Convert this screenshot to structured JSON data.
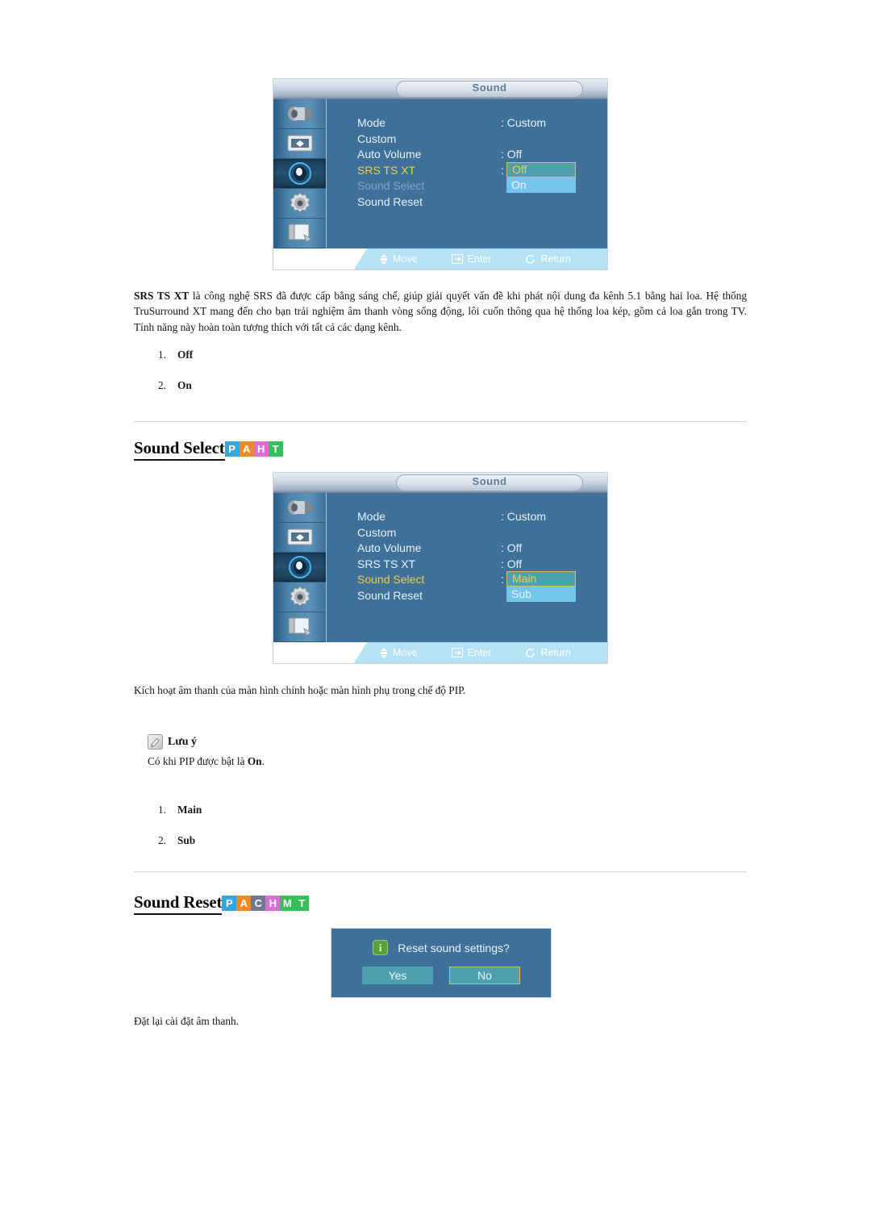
{
  "osd_menu_1": {
    "title": "Sound",
    "sidebar_icons": [
      "input-connector-icon",
      "picture-display-icon",
      "sound-speaker-icon",
      "setup-gear-icon",
      "multi-control-icon"
    ],
    "selected_sidebar_index": 2,
    "rows": [
      {
        "label": "Mode",
        "value": ": Custom",
        "state": "normal"
      },
      {
        "label": "Custom",
        "value": "",
        "state": "normal"
      },
      {
        "label": "Auto Volume",
        "value": ": Off",
        "state": "normal"
      },
      {
        "label": "SRS TS XT",
        "value": ":",
        "state": "active"
      },
      {
        "label": "Sound Select",
        "value": "",
        "state": "dim"
      },
      {
        "label": "Sound Reset",
        "value": "",
        "state": "normal"
      }
    ],
    "popup": {
      "selected": "Off",
      "other": "On"
    },
    "hints": [
      {
        "icon": "move-updown-icon",
        "label": "Move"
      },
      {
        "icon": "enter-key-icon",
        "label": "Enter"
      },
      {
        "icon": "return-arrow-icon",
        "label": "Return"
      }
    ]
  },
  "paragraph_1": {
    "lead": "SRS TS XT",
    "rest": " là công nghệ SRS đã được cấp bằng sáng chế, giúp giải quyết vấn đề khi phát nội dung đa kênh 5.1 bằng hai loa. Hệ thống TruSurround XT mang đến cho bạn trải nghiệm âm thanh vòng sống động, lôi cuốn thông qua hệ thống loa kép, gồm cả loa gắn trong TV. Tính năng này hoàn toàn tương thích với tất cả các dạng kênh."
  },
  "list_1": [
    {
      "num": "1.",
      "text": "Off"
    },
    {
      "num": "2.",
      "text": "On"
    }
  ],
  "heading_sound_select": {
    "text": "Sound Select",
    "badges": [
      {
        "letter": "P",
        "color": "#3aa5dd"
      },
      {
        "letter": "A",
        "color": "#f08a25"
      },
      {
        "letter": "H",
        "color": "#d86fd8"
      },
      {
        "letter": "T",
        "color": "#35c05a"
      }
    ]
  },
  "osd_menu_2": {
    "title": "Sound",
    "sidebar_icons": [
      "input-connector-icon",
      "picture-display-icon",
      "sound-speaker-icon",
      "setup-gear-icon",
      "multi-control-icon"
    ],
    "selected_sidebar_index": 2,
    "rows": [
      {
        "label": "Mode",
        "value": ": Custom",
        "state": "normal"
      },
      {
        "label": "Custom",
        "value": "",
        "state": "normal"
      },
      {
        "label": "Auto Volume",
        "value": ": Off",
        "state": "normal"
      },
      {
        "label": "SRS TS XT",
        "value": ": Off",
        "state": "normal"
      },
      {
        "label": "Sound Select",
        "value": ":",
        "state": "active"
      },
      {
        "label": "Sound Reset",
        "value": "",
        "state": "normal"
      }
    ],
    "popup": {
      "selected": "Main",
      "other": "Sub"
    },
    "hints": [
      {
        "icon": "move-updown-icon",
        "label": "Move"
      },
      {
        "icon": "enter-key-icon",
        "label": "Enter"
      },
      {
        "icon": "return-arrow-icon",
        "label": "Return"
      }
    ]
  },
  "paragraph_2": "Kích hoạt âm thanh của màn hình chính hoặc màn hình phụ trong chế độ PIP.",
  "note": {
    "icon": "note-pencil-icon",
    "title": "Lưu ý",
    "body_pre": "Có khi PIP được bật là ",
    "body_bold": "On",
    "body_post": "."
  },
  "list_2": [
    {
      "num": "1.",
      "text": "Main"
    },
    {
      "num": "2.",
      "text": "Sub"
    }
  ],
  "heading_sound_reset": {
    "text": "Sound Reset",
    "badges": [
      {
        "letter": "P",
        "color": "#3aa5dd"
      },
      {
        "letter": "A",
        "color": "#f08a25"
      },
      {
        "letter": "C",
        "color": "#6f7a8c"
      },
      {
        "letter": "H",
        "color": "#d86fd8"
      },
      {
        "letter": "M",
        "color": "#35c05a"
      },
      {
        "letter": "T",
        "color": "#35c05a"
      }
    ]
  },
  "reset_dialog": {
    "icon": "info-icon",
    "message": "Reset sound settings?",
    "yes_label": "Yes",
    "no_label": "No",
    "focused_button": "No"
  },
  "paragraph_3": "Đặt lại cài đặt âm thanh.",
  "colors": {
    "osd_panel": "#3e7099",
    "osd_bottom_bar": "#b5e2f4",
    "osd_highlight_selected": "#4e9fb0",
    "osd_highlight_alt": "#74c6ec",
    "osd_focus_border": "#c9c46a",
    "osd_active_label": "#f2cf3e",
    "rule": "#d9d9d9"
  }
}
